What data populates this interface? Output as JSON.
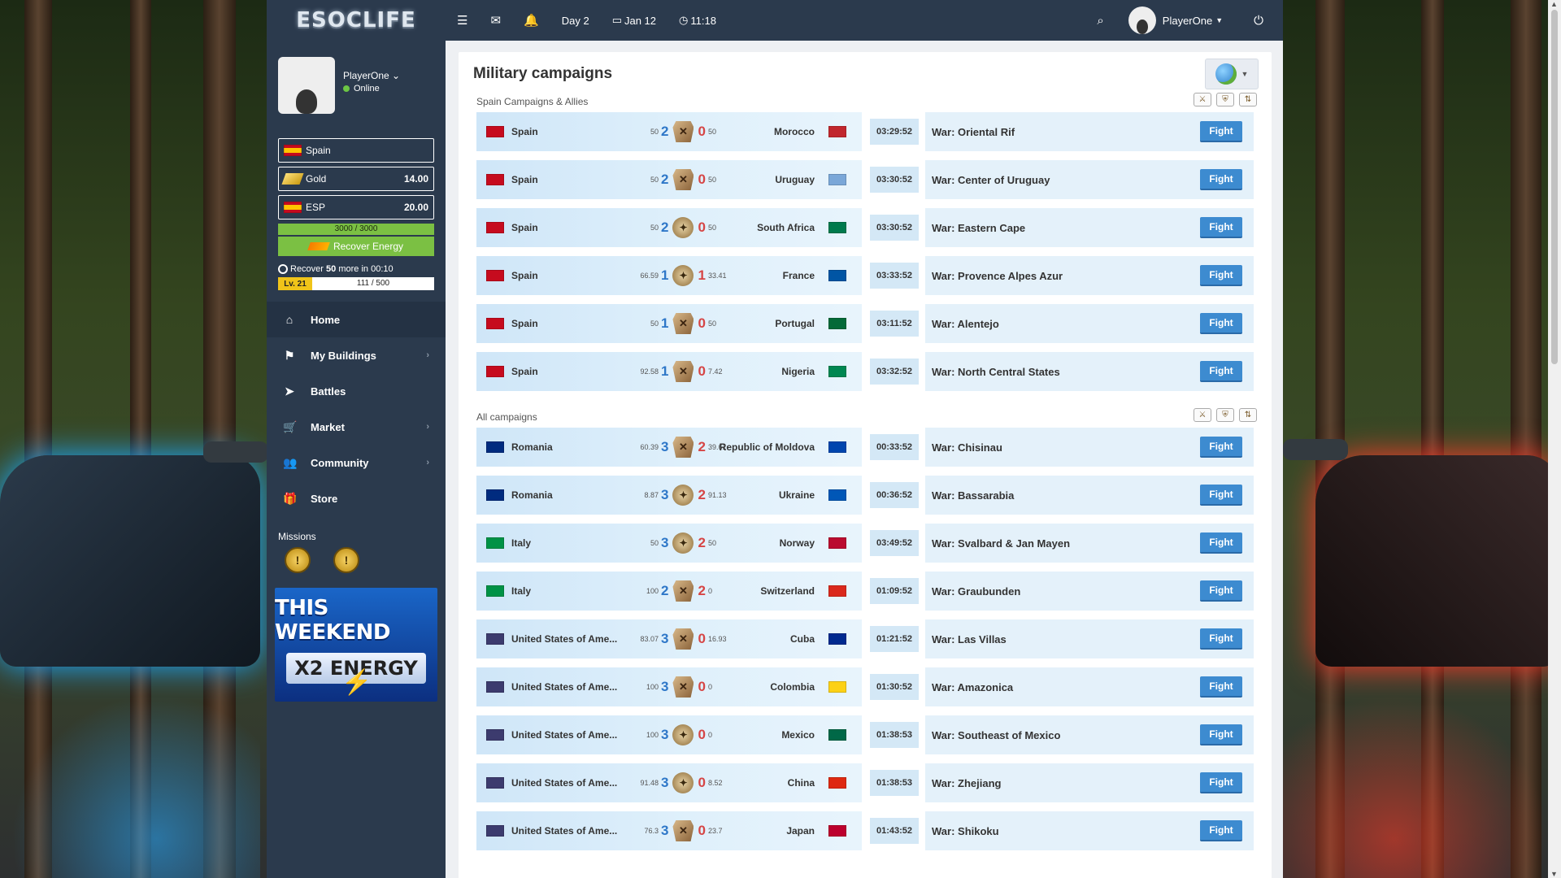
{
  "app": {
    "logo_text": "ESOCLIFE"
  },
  "topbar": {
    "menu_icon": "hamburger-icon",
    "mail_icon": "envelope-icon",
    "bell_icon": "bell-icon",
    "day": "Day 2",
    "date": "Jan 12",
    "time": "11:18",
    "search_icon": "search-icon",
    "user": "PlayerOne",
    "power_icon": "power-icon"
  },
  "profile": {
    "name": "PlayerOne",
    "status": "Online",
    "country": "Spain",
    "gold_label": "Gold",
    "gold_value": "14.00",
    "currency_label": "ESP",
    "currency_value": "20.00",
    "energy": "3000 / 3000",
    "energy_fraction": 1.0,
    "recover_button": "Recover Energy",
    "recover_pre": "Recover",
    "recover_amount": "50",
    "recover_post": "more in 00:10",
    "level": "Lv. 21",
    "xp": "111 / 500",
    "xp_fraction": 0.222
  },
  "nav": [
    {
      "label": "Home",
      "icon": "home-icon",
      "has_sub": false
    },
    {
      "label": "My Buildings",
      "icon": "flag-icon",
      "has_sub": true
    },
    {
      "label": "Battles",
      "icon": "paper-plane-icon",
      "has_sub": false
    },
    {
      "label": "Market",
      "icon": "cart-icon",
      "has_sub": true
    },
    {
      "label": "Community",
      "icon": "users-icon",
      "has_sub": true
    },
    {
      "label": "Store",
      "icon": "gift-icon",
      "has_sub": false
    }
  ],
  "missions_label": "Missions",
  "promo": {
    "title": "THIS WEEKEND",
    "band": "X2 ENERGY"
  },
  "page": {
    "title": "Military campaigns",
    "sections": [
      {
        "label": "Spain Campaigns & Allies",
        "rows": [
          {
            "att": "Spain",
            "att_color": "#c60b1e",
            "att_pct": "50",
            "att_score": "2",
            "badge": "attack",
            "def_score": "0",
            "def_pct": "50",
            "def": "Morocco",
            "def_color": "#c1272d",
            "time": "03:29:52",
            "war": "War: Oriental Rif",
            "action": "Fight"
          },
          {
            "att": "Spain",
            "att_color": "#c60b1e",
            "att_pct": "50",
            "att_score": "2",
            "badge": "attack",
            "def_score": "0",
            "def_pct": "50",
            "def": "Uruguay",
            "def_color": "#7aa7d8",
            "time": "03:30:52",
            "war": "War: Center of Uruguay",
            "action": "Fight"
          },
          {
            "att": "Spain",
            "att_color": "#c60b1e",
            "att_pct": "50",
            "att_score": "2",
            "badge": "defend",
            "def_score": "0",
            "def_pct": "50",
            "def": "South Africa",
            "def_color": "#007a4d",
            "time": "03:30:52",
            "war": "War: Eastern Cape",
            "action": "Fight"
          },
          {
            "att": "Spain",
            "att_color": "#c60b1e",
            "att_pct": "66.59",
            "att_score": "1",
            "badge": "defend",
            "def_score": "1",
            "def_pct": "33.41",
            "def": "France",
            "def_color": "#0055a4",
            "time": "03:33:52",
            "war": "War: Provence Alpes Azur",
            "action": "Fight"
          },
          {
            "att": "Spain",
            "att_color": "#c60b1e",
            "att_pct": "50",
            "att_score": "1",
            "badge": "attack",
            "def_score": "0",
            "def_pct": "50",
            "def": "Portugal",
            "def_color": "#046a38",
            "time": "03:11:52",
            "war": "War: Alentejo",
            "action": "Fight"
          },
          {
            "att": "Spain",
            "att_color": "#c60b1e",
            "att_pct": "92.58",
            "att_score": "1",
            "badge": "attack",
            "def_score": "0",
            "def_pct": "7.42",
            "def": "Nigeria",
            "def_color": "#008751",
            "time": "03:32:52",
            "war": "War: North Central States",
            "action": "Fight"
          }
        ]
      },
      {
        "label": "All campaigns",
        "rows": [
          {
            "att": "Romania",
            "att_color": "#002b7f",
            "att_pct": "60.39",
            "att_score": "3",
            "badge": "attack",
            "def_score": "2",
            "def_pct": "39.61",
            "def": "Republic of Moldova",
            "def_color": "#0046ae",
            "time": "00:33:52",
            "war": "War: Chisinau",
            "action": "Fight"
          },
          {
            "att": "Romania",
            "att_color": "#002b7f",
            "att_pct": "8.87",
            "att_score": "3",
            "badge": "defend",
            "def_score": "2",
            "def_pct": "91.13",
            "def": "Ukraine",
            "def_color": "#0057b7",
            "time": "00:36:52",
            "war": "War: Bassarabia",
            "action": "Fight"
          },
          {
            "att": "Italy",
            "att_color": "#009246",
            "att_pct": "50",
            "att_score": "3",
            "badge": "defend",
            "def_score": "2",
            "def_pct": "50",
            "def": "Norway",
            "def_color": "#ba0c2f",
            "time": "03:49:52",
            "war": "War: Svalbard & Jan Mayen",
            "action": "Fight"
          },
          {
            "att": "Italy",
            "att_color": "#009246",
            "att_pct": "100",
            "att_score": "2",
            "badge": "attack",
            "def_score": "2",
            "def_pct": "0",
            "def": "Switzerland",
            "def_color": "#da291c",
            "time": "01:09:52",
            "war": "War: Graubunden",
            "action": "Fight"
          },
          {
            "att": "United States of Ame...",
            "att_color": "#3c3b6e",
            "att_pct": "83.07",
            "att_score": "3",
            "badge": "attack",
            "def_score": "0",
            "def_pct": "16.93",
            "def": "Cuba",
            "def_color": "#002a8f",
            "time": "01:21:52",
            "war": "War: Las Villas",
            "action": "Fight"
          },
          {
            "att": "United States of Ame...",
            "att_color": "#3c3b6e",
            "att_pct": "100",
            "att_score": "3",
            "badge": "attack",
            "def_score": "0",
            "def_pct": "0",
            "def": "Colombia",
            "def_color": "#fcd116",
            "time": "01:30:52",
            "war": "War: Amazonica",
            "action": "Fight"
          },
          {
            "att": "United States of Ame...",
            "att_color": "#3c3b6e",
            "att_pct": "100",
            "att_score": "3",
            "badge": "defend",
            "def_score": "0",
            "def_pct": "0",
            "def": "Mexico",
            "def_color": "#006847",
            "time": "01:38:53",
            "war": "War: Southeast of Mexico",
            "action": "Fight"
          },
          {
            "att": "United States of Ame...",
            "att_color": "#3c3b6e",
            "att_pct": "91.48",
            "att_score": "3",
            "badge": "defend",
            "def_score": "0",
            "def_pct": "8.52",
            "def": "China",
            "def_color": "#de2910",
            "time": "01:38:53",
            "war": "War: Zhejiang",
            "action": "Fight"
          },
          {
            "att": "United States of Ame...",
            "att_color": "#3c3b6e",
            "att_pct": "76.3",
            "att_score": "3",
            "badge": "attack",
            "def_score": "0",
            "def_pct": "23.7",
            "def": "Japan",
            "def_color": "#bc002d",
            "time": "01:43:52",
            "war": "War: Shikoku",
            "action": "Fight"
          }
        ]
      }
    ]
  }
}
